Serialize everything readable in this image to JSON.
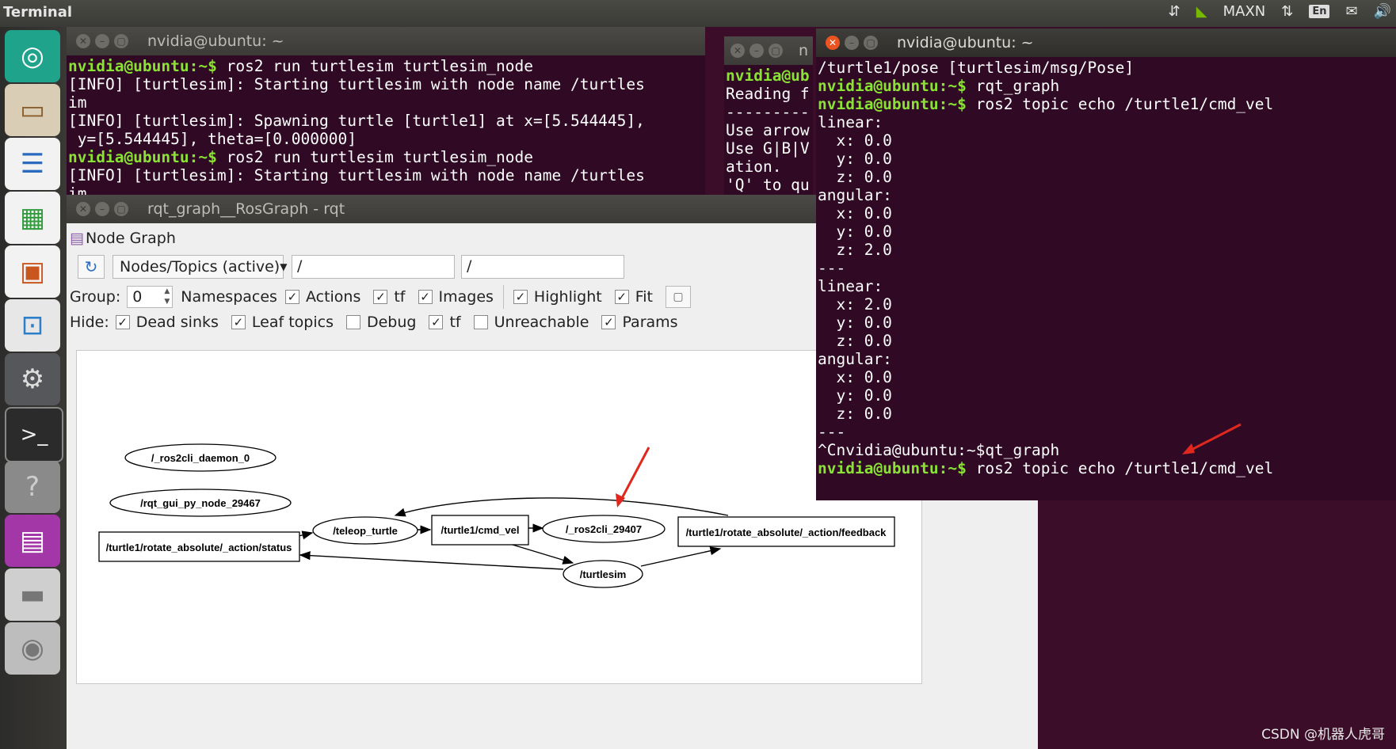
{
  "topbar": {
    "title": "Terminal",
    "tray": {
      "nvidia_label": "MAXN",
      "keyboard": "En"
    }
  },
  "launcher_icons": [
    "ubuntu-icon",
    "files-icon",
    "writer-icon",
    "calc-icon",
    "impress-icon",
    "software-icon",
    "settings-icon",
    "terminal-icon",
    "help-icon",
    "rqt-icon",
    "disk-icon",
    "drive-icon"
  ],
  "win1": {
    "title": "nvidia@ubuntu: ~",
    "lines": [
      {
        "p": "nvidia@ubuntu:~$",
        "t": " ros2 run turtlesim turtlesim_node"
      },
      {
        "p": "",
        "t": "[INFO] [turtlesim]: Starting turtlesim with node name /turtles"
      },
      {
        "p": "",
        "t": "im"
      },
      {
        "p": "",
        "t": "[INFO] [turtlesim]: Spawning turtle [turtle1] at x=[5.544445],"
      },
      {
        "p": "",
        "t": " y=[5.544445], theta=[0.000000]"
      },
      {
        "p": "nvidia@ubuntu:~$",
        "t": " ros2 run turtlesim turtlesim_node"
      },
      {
        "p": "",
        "t": "[INFO] [turtlesim]: Starting turtlesim with node name /turtles"
      },
      {
        "p": "",
        "t": "im"
      }
    ]
  },
  "win2": {
    "title": "n",
    "lines": [
      {
        "p": "nvidia@ub",
        "t": ""
      },
      {
        "p": "",
        "t": "Reading f"
      },
      {
        "p": "",
        "t": "---------"
      },
      {
        "p": "",
        "t": "Use arrow"
      },
      {
        "p": "",
        "t": "Use G|B|V"
      },
      {
        "p": "",
        "t": "ation."
      },
      {
        "p": "",
        "t": "'Q' to qu"
      }
    ]
  },
  "win3": {
    "title": "nvidia@ubuntu: ~",
    "lines": [
      {
        "p": "",
        "t": "/turtle1/pose [turtlesim/msg/Pose]"
      },
      {
        "p": "nvidia@ubuntu:~$",
        "t": " rqt_graph"
      },
      {
        "p": "nvidia@ubuntu:~$",
        "t": " ros2 topic echo /turtle1/cmd_vel"
      },
      {
        "p": "",
        "t": "linear:"
      },
      {
        "p": "",
        "t": "  x: 0.0"
      },
      {
        "p": "",
        "t": "  y: 0.0"
      },
      {
        "p": "",
        "t": "  z: 0.0"
      },
      {
        "p": "",
        "t": "angular:"
      },
      {
        "p": "",
        "t": "  x: 0.0"
      },
      {
        "p": "",
        "t": "  y: 0.0"
      },
      {
        "p": "",
        "t": "  z: 2.0"
      },
      {
        "p": "",
        "t": "---"
      },
      {
        "p": "",
        "t": "linear:"
      },
      {
        "p": "",
        "t": "  x: 2.0"
      },
      {
        "p": "",
        "t": "  y: 0.0"
      },
      {
        "p": "",
        "t": "  z: 0.0"
      },
      {
        "p": "",
        "t": "angular:"
      },
      {
        "p": "",
        "t": "  x: 0.0"
      },
      {
        "p": "",
        "t": "  y: 0.0"
      },
      {
        "p": "",
        "t": "  z: 0.0"
      },
      {
        "p": "",
        "t": "---"
      },
      {
        "p": "",
        "t": "^Cnvidia@ubuntu:~$qt_graph"
      },
      {
        "p": "nvidia@ubuntu:~$",
        "t": " ros2 topic echo /turtle1/cmd_vel"
      }
    ]
  },
  "rqt": {
    "title": "rqt_graph__RosGraph - rqt",
    "panel_title": "Node Graph",
    "mode_select": "Nodes/Topics (active)",
    "filter1": "/",
    "filter2": "/",
    "group_label": "Group:",
    "group_value": "0",
    "namespaces_label": "Namespaces",
    "actions_label": "Actions",
    "tf_label": "tf",
    "images_label": "Images",
    "highlight_label": "Highlight",
    "fit_label": "Fit",
    "hide_label": "Hide:",
    "dead_sinks_label": "Dead sinks",
    "leaf_topics_label": "Leaf topics",
    "debug_label": "Debug",
    "tf2_label": "tf",
    "unreachable_label": "Unreachable",
    "params_label": "Params",
    "check": "✓"
  },
  "graph": {
    "nodes": {
      "daemon": "/_ros2cli_daemon_0",
      "rqtgui": "/rqt_gui_py_node_29467",
      "status": "/turtle1/rotate_absolute/_action/status",
      "teleop": "/teleop_turtle",
      "cmdvel": "/turtle1/cmd_vel",
      "cli": "/_ros2cli_29407",
      "feedback": "/turtle1/rotate_absolute/_action/feedback",
      "turtlesim": "/turtlesim"
    }
  },
  "watermark": "CSDN @机器人虎哥",
  "colors": {
    "terminal_bg": "#300a24",
    "prompt": "#8ae234",
    "arrow": "#e0281e"
  }
}
